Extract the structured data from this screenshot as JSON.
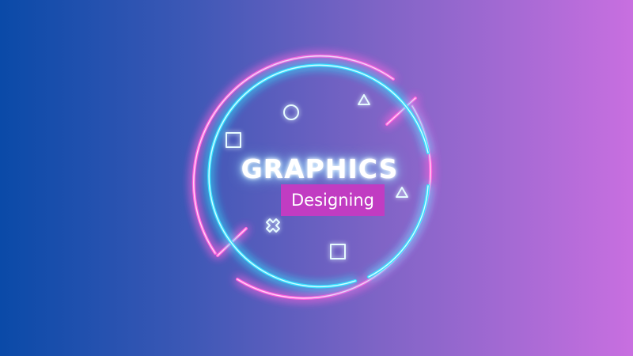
{
  "title": "GRAPHICS",
  "subtitle": "Designing",
  "colors": {
    "background_start": "#0a4aa8",
    "background_end": "#c86fe0",
    "neon_cyan": "#3fe6ff",
    "neon_pink": "#ff4fd8",
    "label_background": "#c13cc2"
  },
  "decorations": [
    "outer-pink-neon-ring",
    "inner-cyan-neon-ring",
    "circle-shape",
    "triangle-shape",
    "square-shape",
    "triangle-shape",
    "x-shape",
    "square-shape"
  ]
}
